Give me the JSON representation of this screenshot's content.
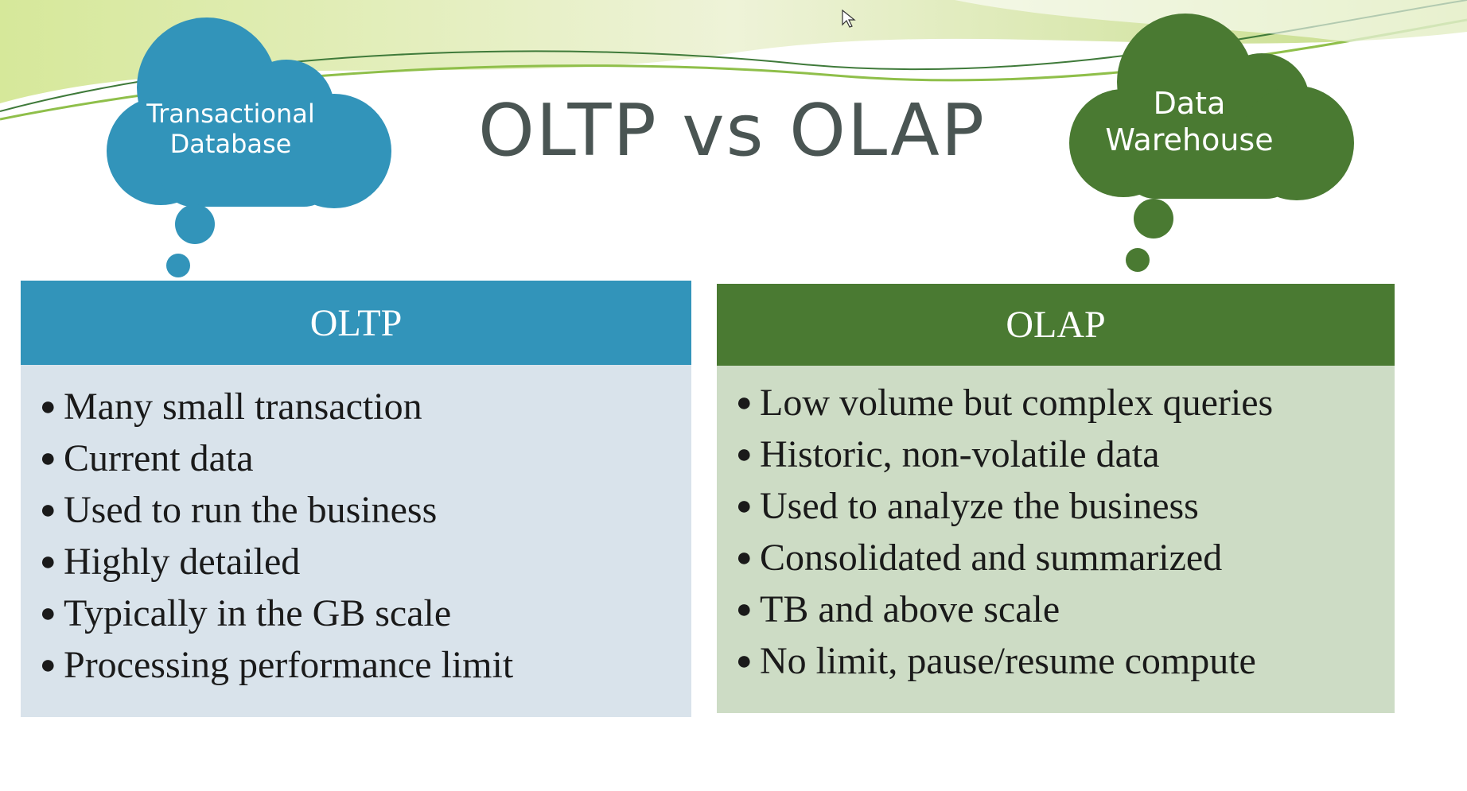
{
  "slide": {
    "title": "OLTP vs OLAP"
  },
  "clouds": {
    "left": {
      "line1": "Transactional",
      "line2": "Database",
      "color": "#3294ba"
    },
    "right": {
      "line1": "Data",
      "line2": "Warehouse",
      "color": "#4a7a32"
    }
  },
  "panels": {
    "oltp": {
      "header": "OLTP",
      "header_color": "#3294ba",
      "body_color": "#d9e3eb",
      "items": [
        "Many small transaction",
        "Current data",
        "Used to run the business",
        "Highly detailed",
        "Typically in the GB scale",
        "Processing performance limit"
      ]
    },
    "olap": {
      "header": "OLAP",
      "header_color": "#4a7a32",
      "body_color": "#cddcc5",
      "items": [
        "Low volume but complex queries",
        "Historic, non-volatile data",
        "Used to analyze the business",
        "Consolidated and summarized",
        "TB and above scale",
        "No limit, pause/resume compute"
      ]
    }
  },
  "icons": {
    "bullet": "bullet-icon",
    "cursor": "cursor-icon"
  }
}
